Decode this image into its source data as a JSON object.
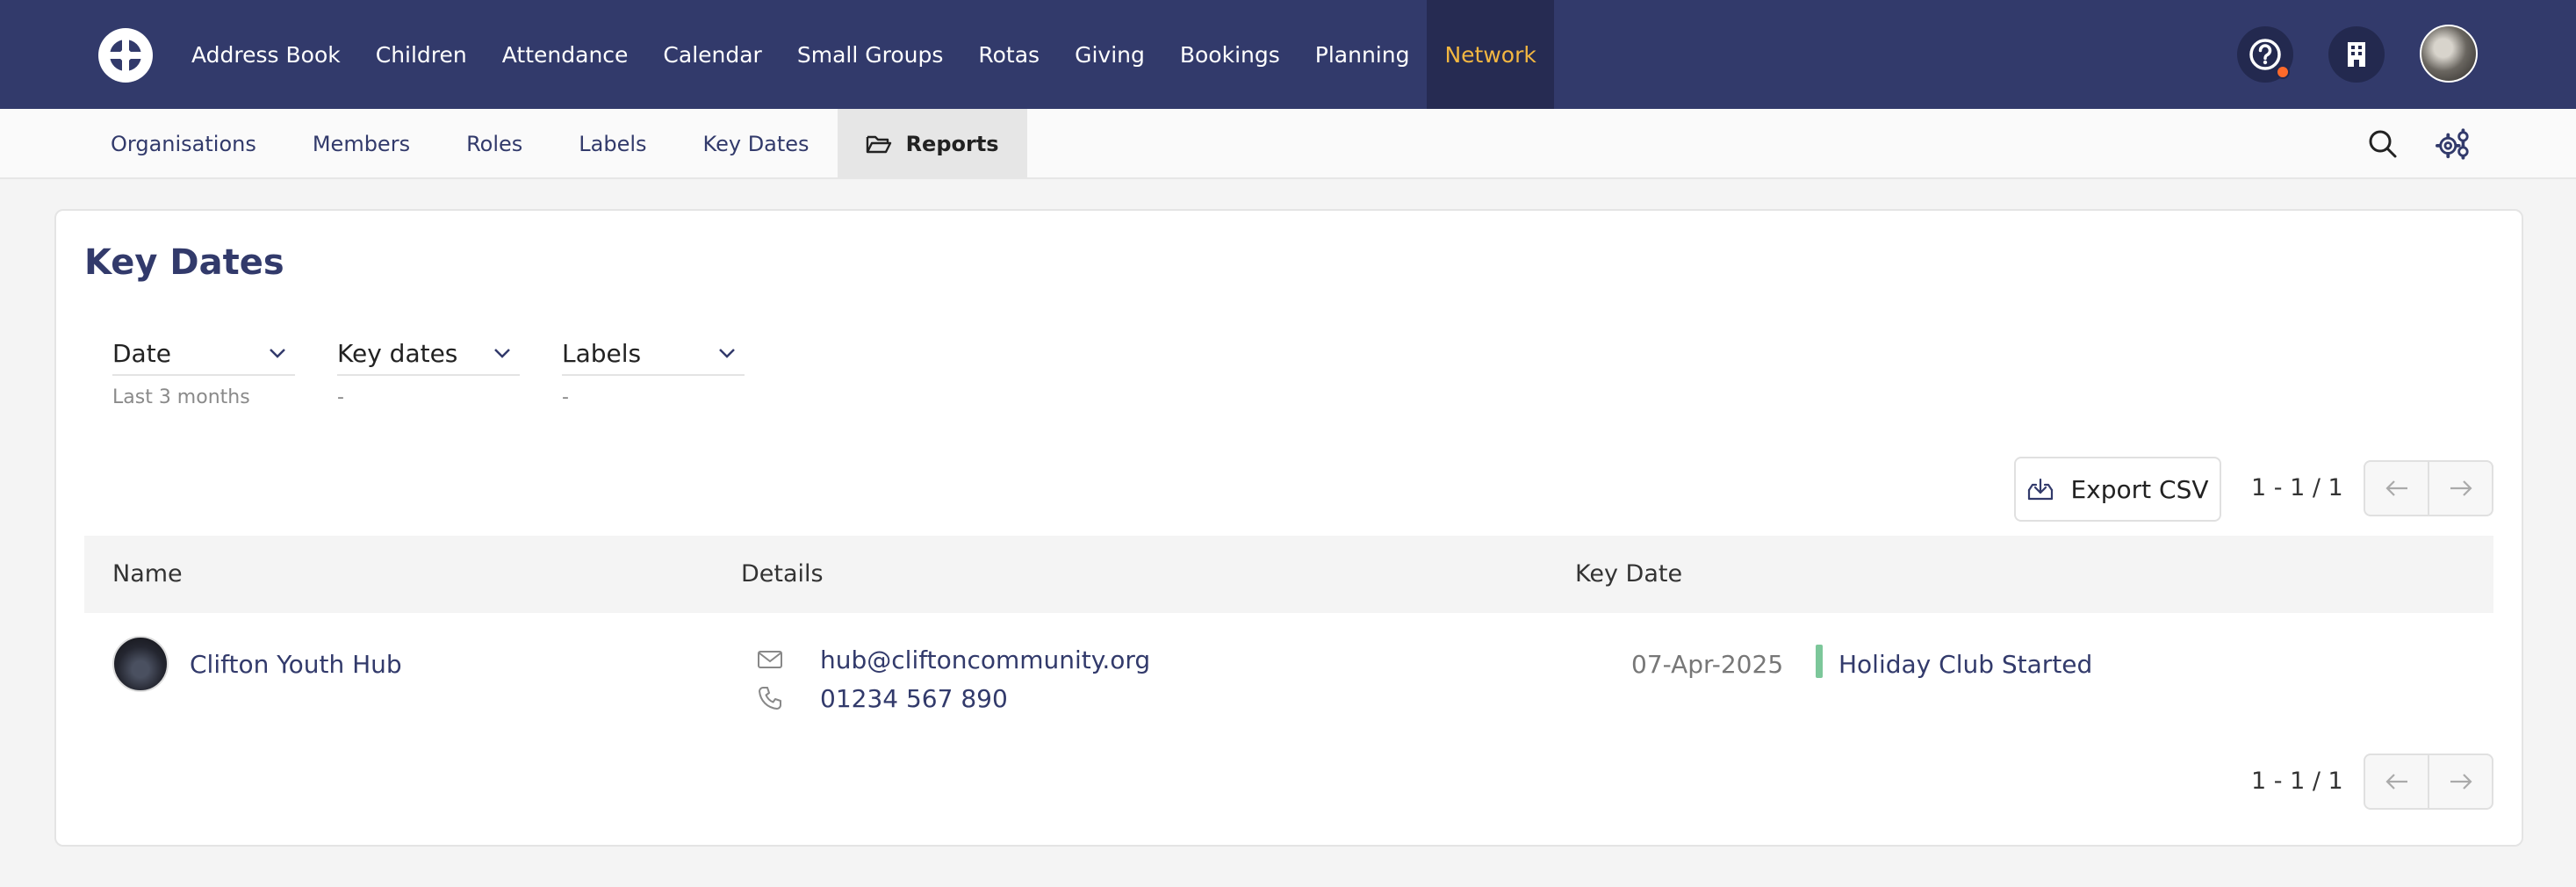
{
  "topnav": {
    "items": [
      {
        "label": "Address Book"
      },
      {
        "label": "Children"
      },
      {
        "label": "Attendance"
      },
      {
        "label": "Calendar"
      },
      {
        "label": "Small Groups"
      },
      {
        "label": "Rotas"
      },
      {
        "label": "Giving"
      },
      {
        "label": "Bookings"
      },
      {
        "label": "Planning"
      },
      {
        "label": "Network",
        "active": true
      }
    ],
    "right_icons": [
      "help-icon",
      "building-icon",
      "avatar"
    ],
    "active_color": "#f3b741",
    "bg_color": "#323a6b"
  },
  "subnav": {
    "items": [
      {
        "label": "Organisations"
      },
      {
        "label": "Members"
      },
      {
        "label": "Roles"
      },
      {
        "label": "Labels"
      },
      {
        "label": "Key Dates"
      },
      {
        "label": "Reports",
        "active": true,
        "icon": "folder-open-icon"
      }
    ],
    "right_icons": [
      "search-icon",
      "settings-icon"
    ]
  },
  "page": {
    "title": "Key Dates"
  },
  "filters": [
    {
      "label": "Date",
      "value": "Last 3 months"
    },
    {
      "label": "Key dates",
      "value": "-"
    },
    {
      "label": "Labels",
      "value": "-"
    }
  ],
  "toolbar": {
    "export_label": "Export CSV",
    "pager_top": "1 - 1 / 1",
    "pager_bottom": "1 - 1 / 1"
  },
  "table": {
    "columns": [
      "Name",
      "Details",
      "Key Date"
    ],
    "rows": [
      {
        "name": "Clifton Youth Hub",
        "email": "hub@cliftoncommunity.org",
        "phone": "01234 567 890",
        "key_date": "07-Apr-2025",
        "key_date_label": "Holiday Club Started",
        "key_date_color": "#7cc79a"
      }
    ]
  }
}
